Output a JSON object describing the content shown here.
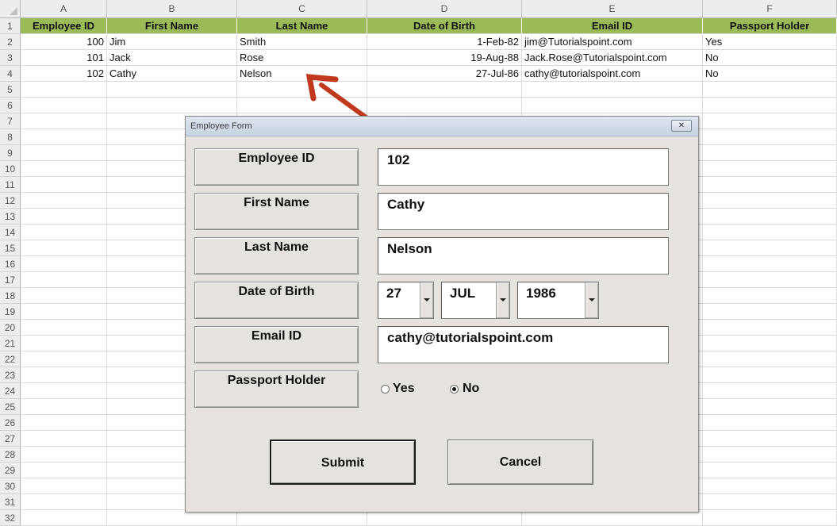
{
  "sheet": {
    "columns": [
      "A",
      "B",
      "C",
      "D",
      "E",
      "F"
    ],
    "row_count": 32,
    "headers": [
      "Employee ID",
      "First Name",
      "Last Name",
      "Date of Birth",
      "Email ID",
      "Passport Holder"
    ],
    "rows": [
      [
        "100",
        "Jim",
        "Smith",
        "1-Feb-82",
        "jim@Tutorialspoint.com",
        "Yes"
      ],
      [
        "101",
        "Jack",
        "Rose",
        "19-Aug-88",
        "Jack.Rose@Tutorialspoint.com",
        "No"
      ],
      [
        "102",
        "Cathy",
        "Nelson",
        "27-Jul-86",
        "cathy@tutorialspoint.com",
        "No"
      ]
    ],
    "header_color": "#9bbb59"
  },
  "annotation": {
    "arrow_color": "#c0391e"
  },
  "form": {
    "title": "Employee Form",
    "close_label": "✕",
    "labels": {
      "employee_id": "Employee ID",
      "first_name": "First Name",
      "last_name": "Last Name",
      "dob": "Date of Birth",
      "email": "Email ID",
      "passport": "Passport Holder"
    },
    "values": {
      "employee_id": "102",
      "first_name": "Cathy",
      "last_name": "Nelson",
      "dob_day": "27",
      "dob_month": "JUL",
      "dob_year": "1986",
      "email": "cathy@tutorialspoint.com"
    },
    "passport_options": {
      "yes": "Yes",
      "no": "No",
      "selected": "No"
    },
    "buttons": {
      "submit": "Submit",
      "cancel": "Cancel"
    }
  }
}
